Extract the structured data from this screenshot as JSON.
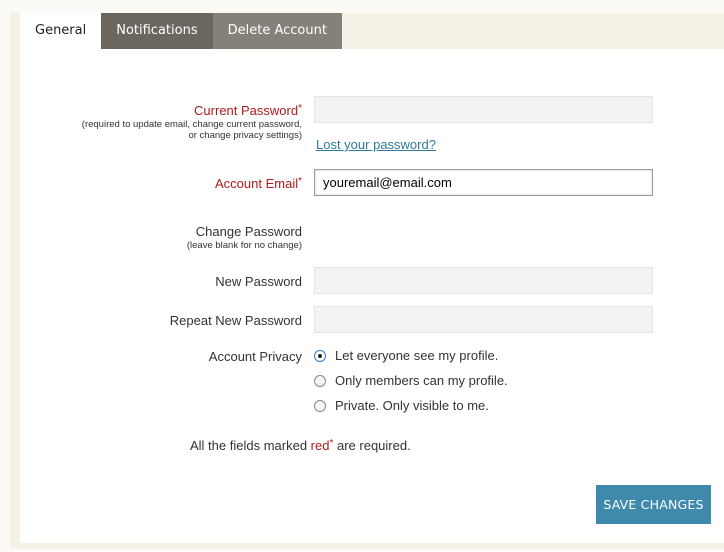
{
  "tabs": [
    {
      "label": "General",
      "active": true
    },
    {
      "label": "Notifications",
      "active": false
    },
    {
      "label": "Delete Account",
      "active": false
    }
  ],
  "form": {
    "current_password": {
      "label": "Current Password",
      "required_mark": "*",
      "hint_line1": "(required to update email, change current password,",
      "hint_line2": "or change privacy settings)",
      "value": ""
    },
    "lost_password_link": "Lost your password?",
    "account_email": {
      "label": "Account Email",
      "required_mark": "*",
      "value": "youremail@email.com"
    },
    "change_password": {
      "heading": "Change Password",
      "hint": "(leave blank for no change)"
    },
    "new_password": {
      "label": "New Password",
      "value": ""
    },
    "repeat_password": {
      "label": "Repeat New Password",
      "value": ""
    },
    "privacy": {
      "label": "Account Privacy",
      "options": [
        {
          "label": "Let everyone see my profile.",
          "checked": true
        },
        {
          "label": "Only members can my profile.",
          "checked": false
        },
        {
          "label": "Private. Only visible to me.",
          "checked": false
        }
      ]
    },
    "required_note": {
      "prefix": "All the fields marked ",
      "red_word": "red",
      "star": "*",
      "suffix": " are required."
    },
    "save_label": "Save Changes"
  },
  "colors": {
    "required_red": "#b01b1b",
    "link_blue": "#2f7a9c",
    "button_blue": "#3f8aac",
    "tab_dark": "#6a675f"
  }
}
